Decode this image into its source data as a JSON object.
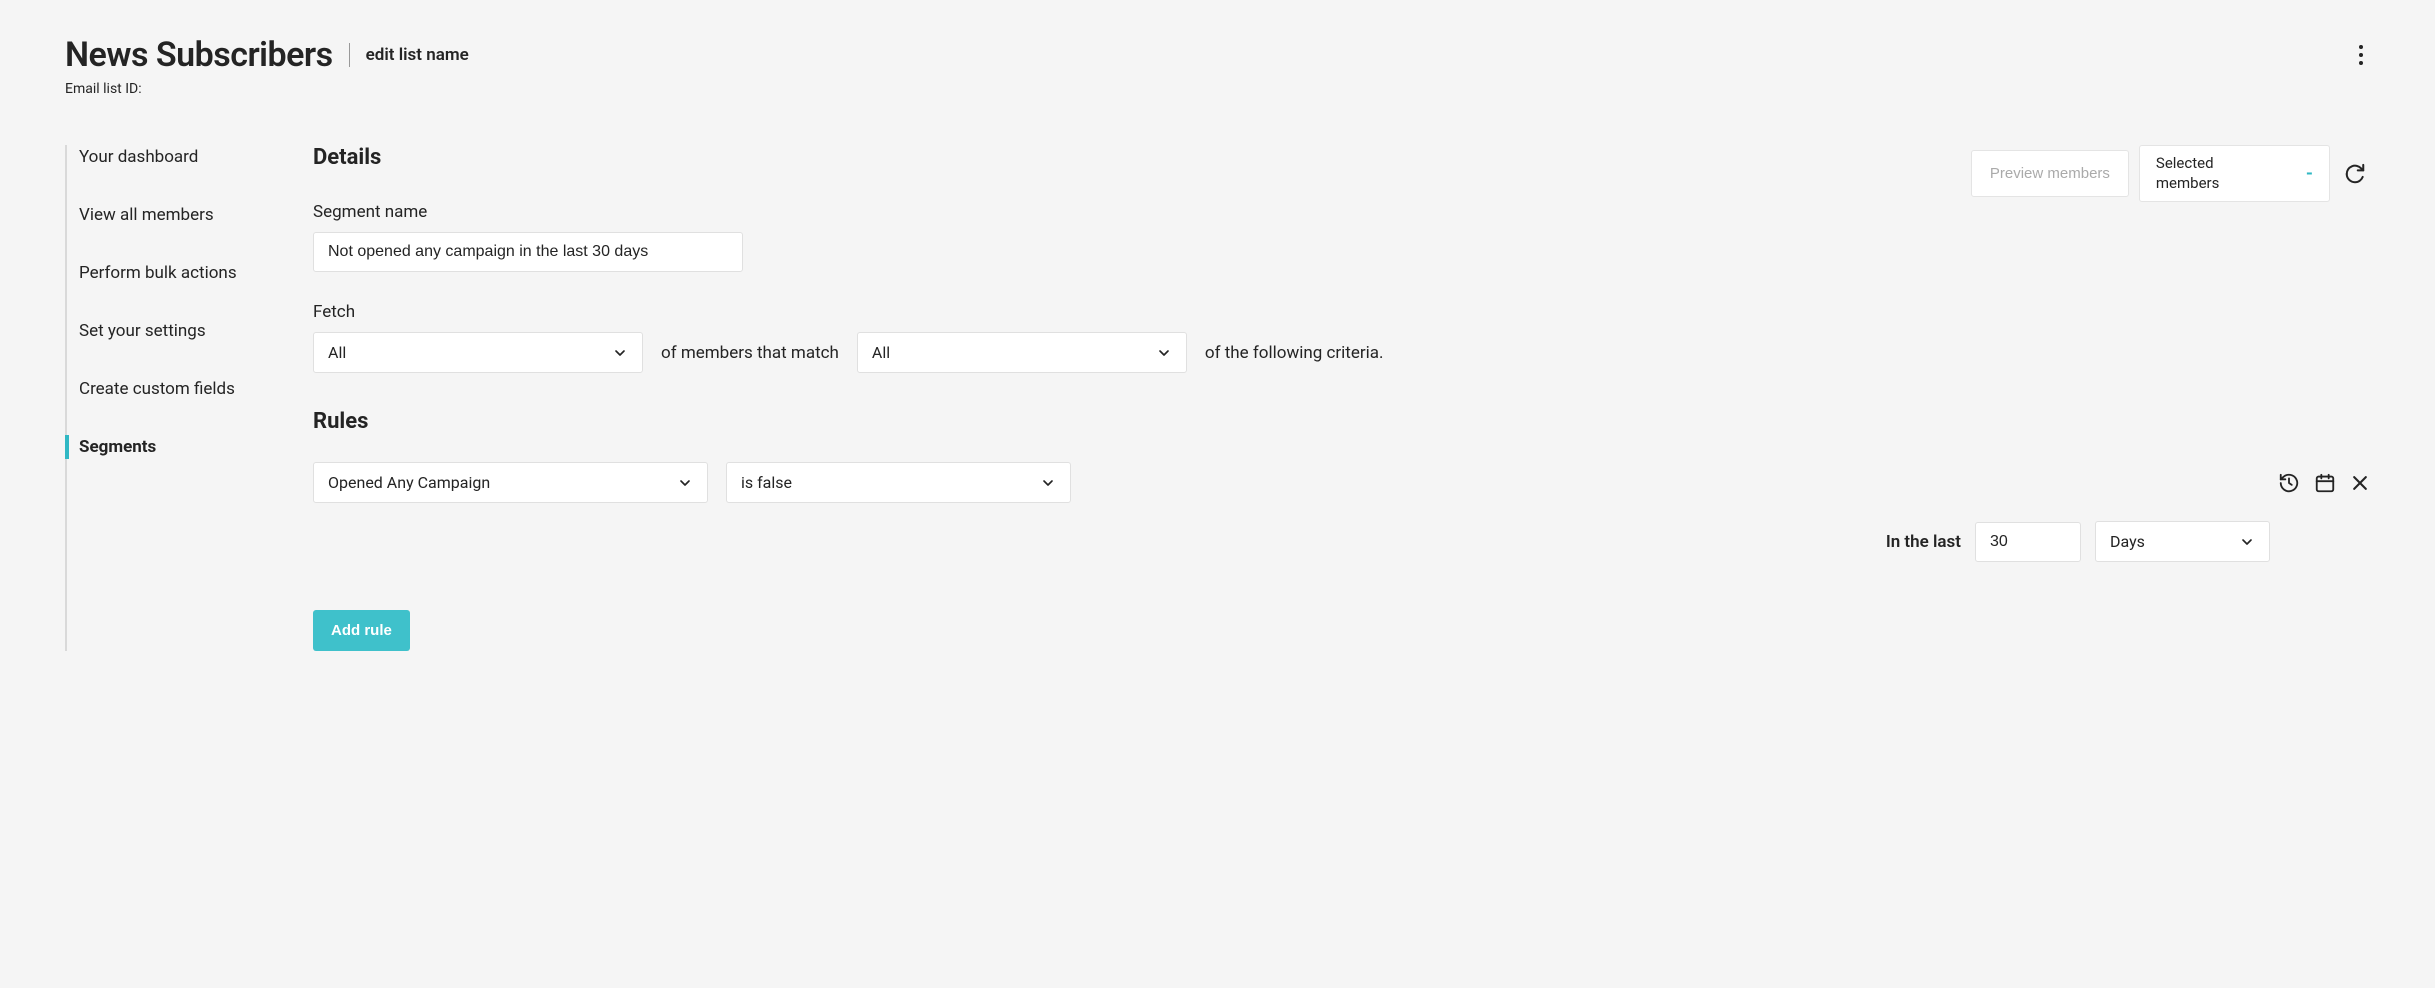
{
  "header": {
    "title": "News Subscribers",
    "edit_link": "edit list name",
    "list_id_label": "Email list ID:"
  },
  "sidebar": {
    "items": [
      {
        "label": "Your dashboard",
        "active": false
      },
      {
        "label": "View all members",
        "active": false
      },
      {
        "label": "Perform bulk actions",
        "active": false
      },
      {
        "label": "Set your settings",
        "active": false
      },
      {
        "label": "Create custom fields",
        "active": false
      },
      {
        "label": "Segments",
        "active": true
      }
    ]
  },
  "preview": {
    "button_label": "Preview members",
    "selected_label": "Selected members",
    "selected_value": "-"
  },
  "details": {
    "heading": "Details",
    "segment_name_label": "Segment name",
    "segment_name_value": "Not opened any campaign in the last 30 days",
    "fetch_label": "Fetch",
    "fetch_scope": "All",
    "fetch_mid_text": "of members that match",
    "fetch_match": "All",
    "fetch_tail_text": "of the following criteria."
  },
  "rules": {
    "heading": "Rules",
    "rule1": {
      "field": "Opened Any Campaign",
      "operator": "is false",
      "timeframe_label": "In the last",
      "timeframe_value": "30",
      "timeframe_unit": "Days"
    },
    "add_button": "Add rule"
  }
}
